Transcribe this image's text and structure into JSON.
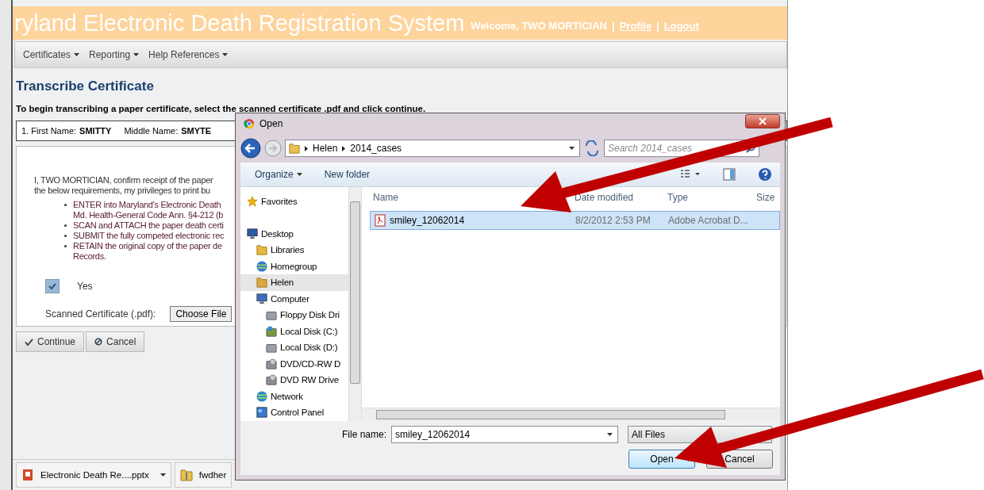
{
  "header": {
    "title": "ryland Electronic Death Registration System",
    "items": [
      {
        "kind": "text",
        "label": "Welcome, TWO MORTICIAN"
      },
      {
        "kind": "sep",
        "label": "|"
      },
      {
        "kind": "link",
        "label": "Profile"
      },
      {
        "kind": "sep",
        "label": "|"
      },
      {
        "kind": "link",
        "label": "Logout"
      }
    ]
  },
  "menu": [
    "Certificates",
    "Reporting",
    "Help References"
  ],
  "page_title": "Transcribe Certificate",
  "instruction": "To begin transcribing a paper certificate, select the scanned certificate .pdf and click continue.",
  "name_bar": [
    {
      "label": "1. First Name:",
      "value": "SMITTY"
    },
    {
      "label": "Middle Name:",
      "value": "SMYTE"
    }
  ],
  "confirmation": [
    "I, TWO MORTICIAN, confirm receipt of the paper",
    "the below requirements, my privileges to print bu"
  ],
  "requirements": [
    {
      "lines": [
        "ENTER into Maryland's Electronic Death",
        "Md. Health-General Code Ann. §4-212 (b"
      ]
    },
    {
      "lines": [
        "SCAN and ATTACH the paper death certi"
      ]
    },
    {
      "lines": [
        "SUBMIT the fully competed electronic rec"
      ]
    },
    {
      "lines": [
        "RETAIN the original copy of the paper de",
        "Records."
      ]
    }
  ],
  "agree": {
    "label": "Yes",
    "checked": true
  },
  "upload": {
    "label": "Scanned Certificate (.pdf):",
    "button": "Choose File"
  },
  "actions": [
    {
      "kind": "continue",
      "label": "Continue"
    },
    {
      "kind": "cancel",
      "label": "Cancel"
    }
  ],
  "downloads": [
    {
      "kind": "slides",
      "label": "Electronic Death Re....pptx"
    },
    {
      "kind": "folder",
      "label": "fwdher"
    }
  ],
  "dialog": {
    "title": "Open",
    "breadcrumb": [
      "Helen",
      "2014_cases"
    ],
    "search": {
      "placeholder": "Search 2014_cases"
    },
    "toolbar": [
      "Organize",
      "New folder"
    ],
    "tree": [
      {
        "label": "Favorites",
        "kind": "star",
        "selected": false
      },
      {
        "label": "Desktop",
        "kind": "desktop",
        "selected": false,
        "children": [
          {
            "label": "Libraries",
            "kind": "library",
            "selected": false
          },
          {
            "label": "Homegroup",
            "kind": "homegroup",
            "selected": false
          },
          {
            "label": "Helen",
            "kind": "user",
            "selected": true
          },
          {
            "label": "Computer",
            "kind": "computer",
            "selected": false,
            "children": [
              {
                "label": "Floppy Disk Dri",
                "kind": "drive",
                "selected": false
              },
              {
                "label": "Local Disk (C:)",
                "kind": "system-drive",
                "selected": false
              },
              {
                "label": "Local Disk (D:)",
                "kind": "drive",
                "selected": false
              },
              {
                "label": "DVD/CD-RW D",
                "kind": "optical",
                "selected": false
              },
              {
                "label": "DVD RW Drive",
                "kind": "optical",
                "selected": false
              }
            ]
          },
          {
            "label": "Network",
            "kind": "network",
            "selected": false
          },
          {
            "label": "Control Panel",
            "kind": "control",
            "selected": false
          }
        ]
      }
    ],
    "columns": [
      "Name",
      "Date modified",
      "Type",
      "Size"
    ],
    "files": [
      {
        "name": "smiley_12062014",
        "date": "8/2/2012 2:53 PM",
        "type": "Adobe Acrobat D...",
        "selected": true
      }
    ],
    "file_name_label": "File name:",
    "file_name": "smiley_12062014",
    "filter": "All Files",
    "buttons": [
      {
        "kind": "primary",
        "label": "Open"
      },
      {
        "kind": "plain",
        "label": "Cancel"
      }
    ]
  }
}
